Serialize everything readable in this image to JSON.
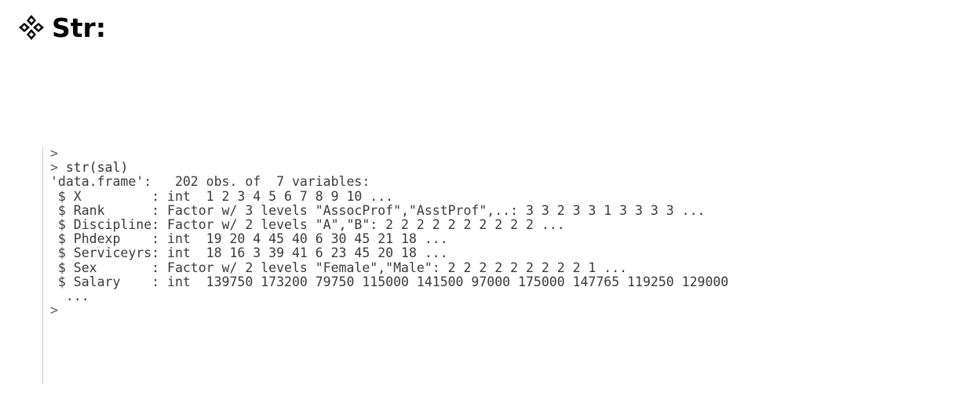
{
  "heading": {
    "title": "Str:",
    "bullet_icon": "four-diamonds-icon"
  },
  "console": {
    "lines": [
      {
        "prompt": ">",
        "text": ""
      },
      {
        "prompt": "> ",
        "text": "str(sal)"
      },
      {
        "prompt": "",
        "text": "'data.frame':   202 obs. of  7 variables:"
      },
      {
        "prompt": "",
        "text": " $ X         : int  1 2 3 4 5 6 7 8 9 10 ..."
      },
      {
        "prompt": "",
        "text": " $ Rank      : Factor w/ 3 levels \"AssocProf\",\"AsstProf\",..: 3 3 2 3 3 1 3 3 3 3 ..."
      },
      {
        "prompt": "",
        "text": " $ Discipline: Factor w/ 2 levels \"A\",\"B\": 2 2 2 2 2 2 2 2 2 2 ..."
      },
      {
        "prompt": "",
        "text": " $ Phdexp    : int  19 20 4 45 40 6 30 45 21 18 ..."
      },
      {
        "prompt": "",
        "text": " $ Serviceyrs: int  18 16 3 39 41 6 23 45 20 18 ..."
      },
      {
        "prompt": "",
        "text": " $ Sex       : Factor w/ 2 levels \"Female\",\"Male\": 2 2 2 2 2 2 2 2 2 1 ..."
      },
      {
        "prompt": "",
        "text": " $ Salary    : int  139750 173200 79750 115000 141500 97000 175000 147765 119250 129000"
      },
      {
        "prompt": "",
        "text": "  ..."
      },
      {
        "prompt": ">",
        "text": ""
      }
    ]
  }
}
